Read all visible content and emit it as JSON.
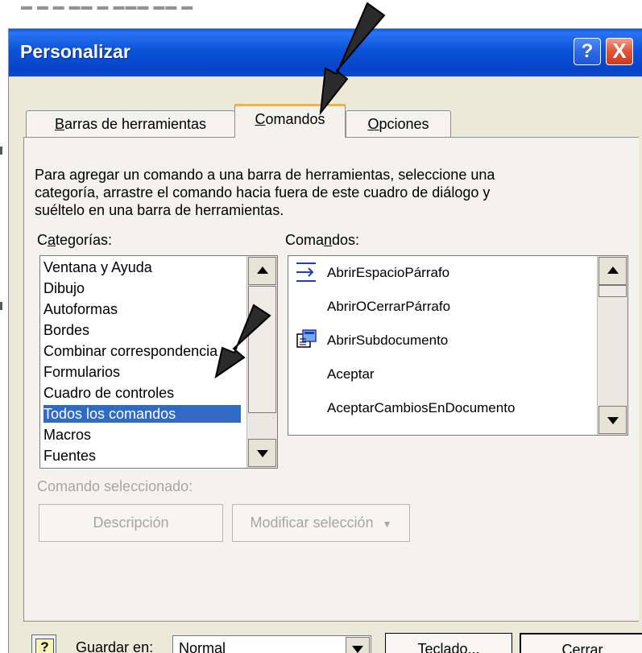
{
  "dialog": {
    "title": "Personalizar",
    "help_button": "?",
    "close_button": "X"
  },
  "tabs": [
    {
      "label": "Barras de herramientas",
      "underline_char": "B",
      "rest": "arras de herramientas",
      "selected": false
    },
    {
      "label": "Comandos",
      "underline_char": "C",
      "rest": "omandos",
      "selected": true
    },
    {
      "label": "Opciones",
      "underline_char": "O",
      "rest": "pciones",
      "selected": false
    }
  ],
  "instructions": "Para agregar un comando a una barra de herramientas, seleccione una\ncategoría, arrastre el comando hacia fuera de este cuadro de diálogo y\nsuéltelo en una barra de herramientas.",
  "categories": {
    "label_prefix": "C",
    "label_underline": "a",
    "label_rest": "tegorías:",
    "items": [
      "Ventana y Ayuda",
      "Dibujo",
      "Autoformas",
      "Bordes",
      "Combinar correspondencia",
      "Formularios",
      "Cuadro de controles",
      "Todos los comandos",
      "Macros",
      "Fuentes"
    ],
    "selected": "Todos los comandos"
  },
  "commands": {
    "label_prefix": "Coma",
    "label_underline": "n",
    "label_rest": "dos:",
    "items": [
      {
        "label": "AbrirEspacioPárrafo",
        "icon": "paragraph-spacing-icon"
      },
      {
        "label": "AbrirOCerrarPárrafo",
        "icon": "none"
      },
      {
        "label": "AbrirSubdocumento",
        "icon": "subdocument-icon"
      },
      {
        "label": "Aceptar",
        "icon": "none"
      },
      {
        "label": "AceptarCambiosEnDocumento",
        "icon": "none"
      }
    ]
  },
  "selected_command": {
    "label": "Comando seleccionado:",
    "description_button": "Descripción",
    "modify_button": "Modificar selección"
  },
  "footer": {
    "help_icon_text": "?",
    "save_label_prefix": "Guardar ",
    "save_label_underline": "e",
    "save_label_rest": "n:",
    "save_value": "Normal",
    "keyboard_underline": "T",
    "keyboard_rest": "eclado...",
    "close_label": "Cerrar"
  },
  "colors": {
    "titlebar": "#0b52d9",
    "selection": "#316ac5",
    "active_tab_accent": "#f7b23b",
    "dialog_background": "#ece9d8"
  },
  "annotations": {
    "arrows": 2,
    "arrow_color": "#2b2b2b"
  }
}
